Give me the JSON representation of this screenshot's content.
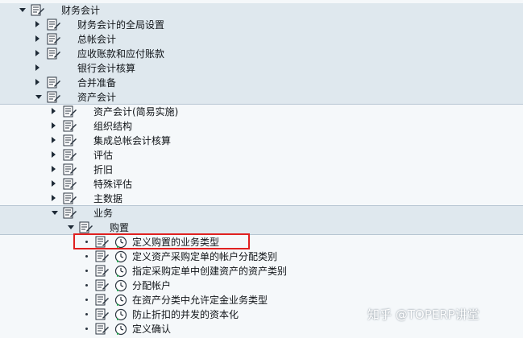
{
  "tree": {
    "rows": [
      {
        "label": "财务会计",
        "indent": 0,
        "expand": "down",
        "clock": false
      },
      {
        "label": "财务会计的全局设置",
        "indent": 1,
        "expand": "right",
        "clock": false
      },
      {
        "label": "总帐会计",
        "indent": 1,
        "expand": "right",
        "clock": false
      },
      {
        "label": "应收账款和应付账款",
        "indent": 1,
        "expand": "right",
        "clock": false
      },
      {
        "label": "银行会计核算",
        "indent": 1,
        "expand": "right",
        "clock": false,
        "noicon": true
      },
      {
        "label": "合并准备",
        "indent": 1,
        "expand": "right",
        "clock": false
      },
      {
        "label": "资产会计",
        "indent": 1,
        "expand": "down",
        "clock": false
      },
      {
        "label": "资产会计(简易实施)",
        "indent": 2,
        "expand": "right",
        "clock": false
      },
      {
        "label": "组织结构",
        "indent": 2,
        "expand": "right",
        "clock": false
      },
      {
        "label": "集成总帐会计核算",
        "indent": 2,
        "expand": "right",
        "clock": false
      },
      {
        "label": "评估",
        "indent": 2,
        "expand": "right",
        "clock": false
      },
      {
        "label": "折旧",
        "indent": 2,
        "expand": "right",
        "clock": false
      },
      {
        "label": "特殊评估",
        "indent": 2,
        "expand": "right",
        "clock": false
      },
      {
        "label": "主数据",
        "indent": 2,
        "expand": "right",
        "clock": false
      },
      {
        "label": "业务",
        "indent": 2,
        "expand": "down",
        "clock": false
      },
      {
        "label": "购置",
        "indent": 3,
        "expand": "down",
        "clock": false
      },
      {
        "label": "定义购置的业务类型",
        "indent": 4,
        "expand": "bullet",
        "clock": true,
        "highlight": true
      },
      {
        "label": "定义资产采购定单的帐户分配类别",
        "indent": 4,
        "expand": "bullet",
        "clock": true
      },
      {
        "label": "指定采购定单中创建资产的资产类别",
        "indent": 4,
        "expand": "bullet",
        "clock": true
      },
      {
        "label": "分配帐户",
        "indent": 4,
        "expand": "bullet",
        "clock": true
      },
      {
        "label": "在资产分类中允许定金业务类型",
        "indent": 4,
        "expand": "bullet",
        "clock": true
      },
      {
        "label": "防止折扣的并发的资本化",
        "indent": 4,
        "expand": "bullet",
        "clock": true
      },
      {
        "label": "定义确认",
        "indent": 4,
        "expand": "bullet",
        "clock": true
      }
    ]
  },
  "watermark": "知乎 @TOPERP讲堂",
  "colors": {
    "band": "#dfe8ee",
    "highlight": "#e02020",
    "text": "#101418"
  }
}
